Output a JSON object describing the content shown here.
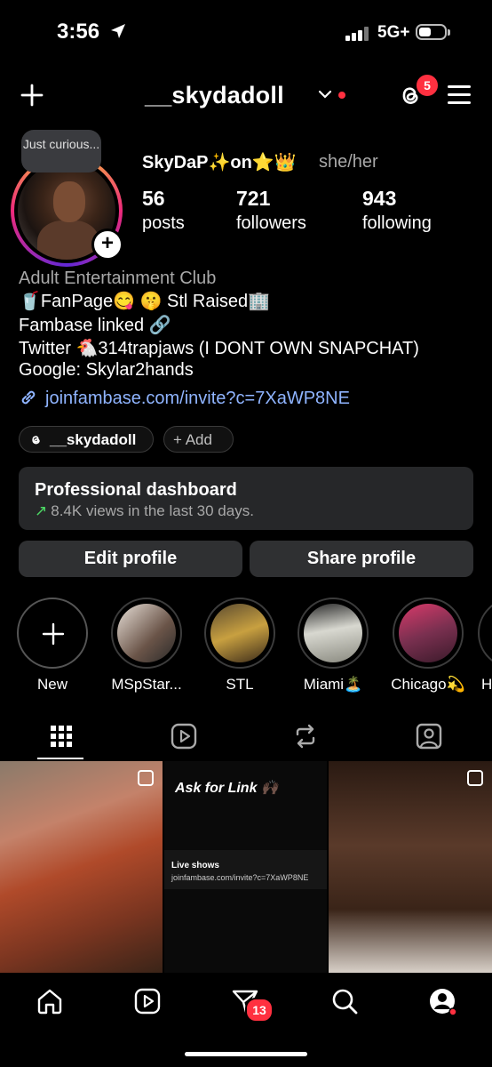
{
  "status": {
    "time": "3:56",
    "network": "5G+"
  },
  "header": {
    "username": "__skydadoll",
    "threads_badge": "5"
  },
  "profile": {
    "note": "Just curious...",
    "display_name": "SkyDaP✨on⭐👑",
    "pronouns": "she/her",
    "stats": [
      {
        "value": "56",
        "label": "posts"
      },
      {
        "value": "721",
        "label": "followers"
      },
      {
        "value": "943",
        "label": "following"
      }
    ],
    "category": "Adult Entertainment Club",
    "bio": [
      "🥤FanPage😋 🤫 Stl Raised🏢",
      "Fambase linked 🔗",
      "Twitter 🐔314trapjaws (I DONT OWN SNAPCHAT)",
      "Google: Skylar2hands"
    ],
    "link": "joinfambase.com/invite?c=7XaWP8NE",
    "threads_pill": "__skydadoll",
    "add_pill": "+ Add"
  },
  "dashboard": {
    "title": "Professional dashboard",
    "subtitle": "8.4K views in the last 30 days."
  },
  "buttons": {
    "edit": "Edit profile",
    "share": "Share profile"
  },
  "highlights": [
    {
      "label": "New"
    },
    {
      "label": "MSpStar..."
    },
    {
      "label": "STL"
    },
    {
      "label": "Miami🏝️"
    },
    {
      "label": "Chicago💫"
    },
    {
      "label": "H"
    }
  ],
  "grid": {
    "post2_title": "Ask for Link 🙌🏿",
    "post2_live": "Live shows",
    "post2_url": "joinfambase.com/invite?c=7XaWP8NE"
  },
  "nav": {
    "messages_badge": "13"
  }
}
